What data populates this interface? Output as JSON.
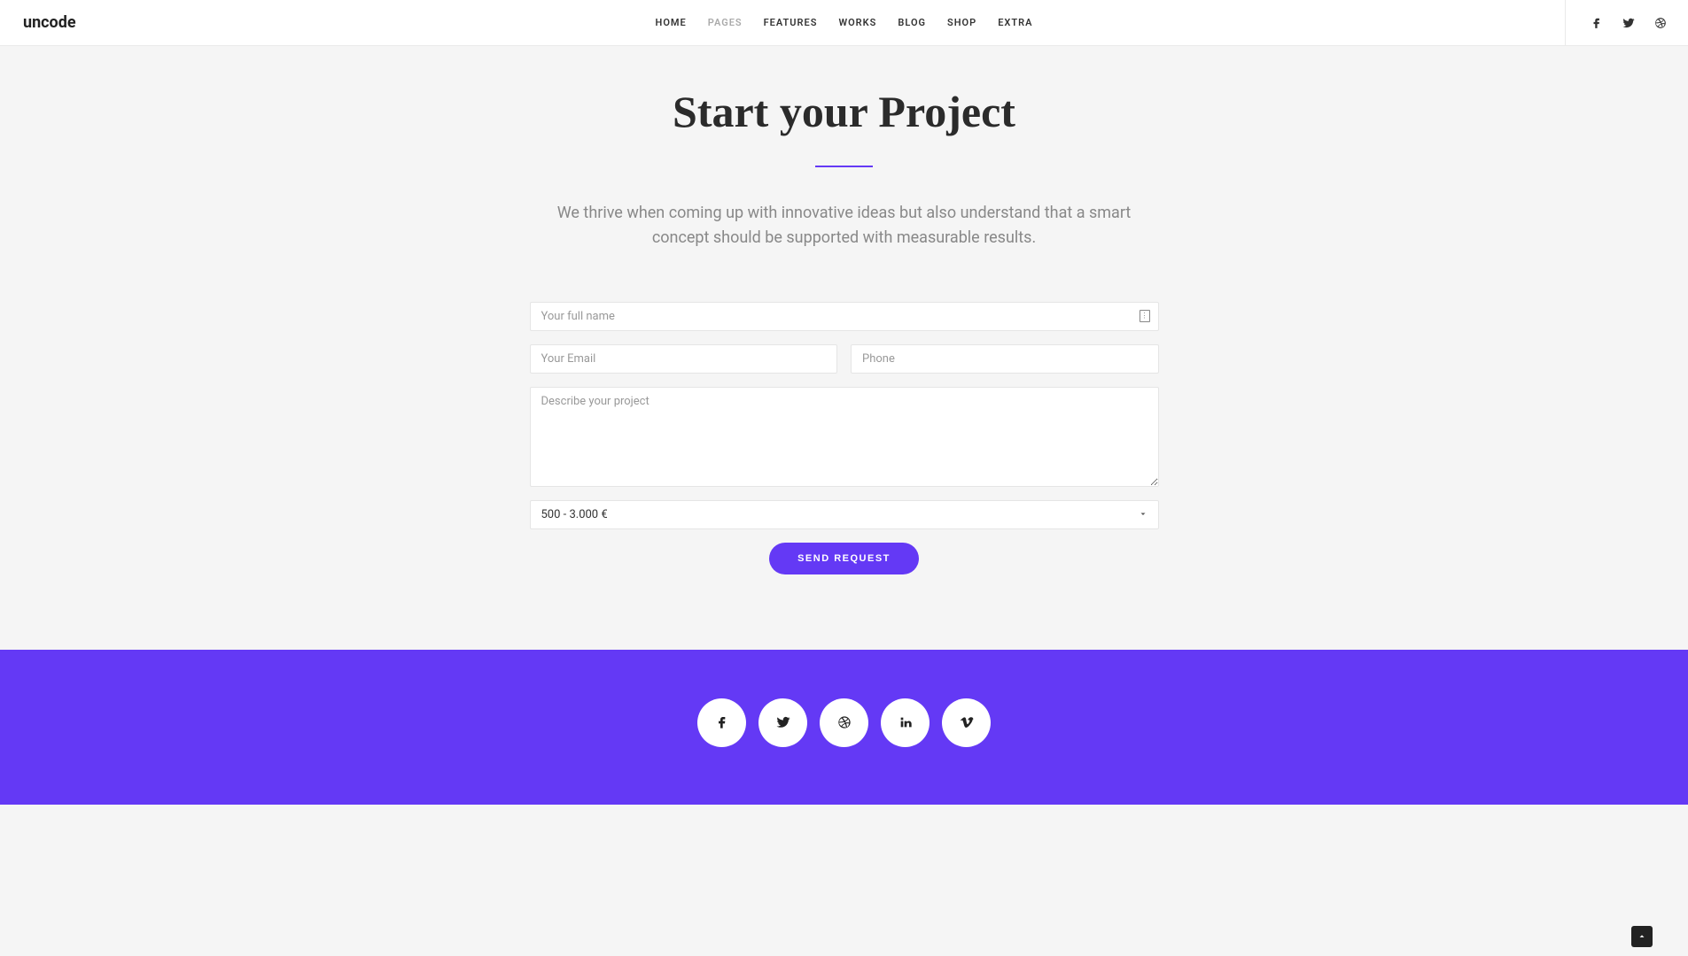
{
  "brand": "uncode",
  "nav": {
    "items": [
      {
        "label": "HOME"
      },
      {
        "label": "PAGES"
      },
      {
        "label": "FEATURES"
      },
      {
        "label": "WORKS"
      },
      {
        "label": "BLOG"
      },
      {
        "label": "SHOP"
      },
      {
        "label": "EXTRA"
      }
    ],
    "active_index": 1
  },
  "hero": {
    "title": "Start your Project",
    "subtitle": "We thrive when coming up with innovative ideas but also understand that a smart concept should be supported with measurable results."
  },
  "form": {
    "name_placeholder": "Your full name",
    "email_placeholder": "Your Email",
    "phone_placeholder": "Phone",
    "description_placeholder": "Describe your project",
    "budget_selected": "500 - 3.000 €",
    "submit_label": "SEND REQUEST"
  },
  "colors": {
    "accent": "#6439f5"
  }
}
